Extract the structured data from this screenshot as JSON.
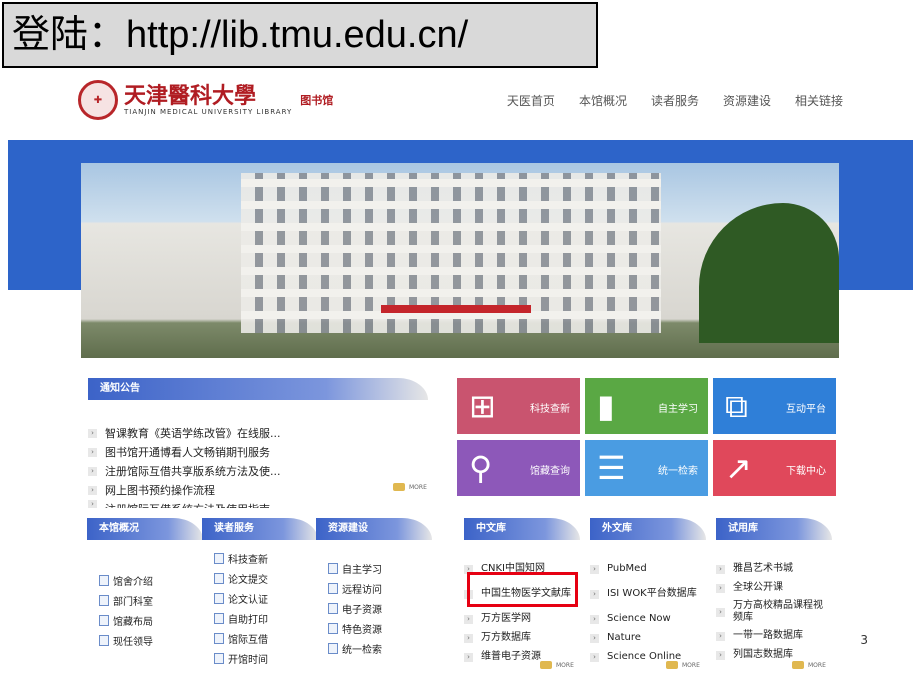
{
  "slide": {
    "title": "登陆：http://lib.tmu.edu.cn/",
    "page_number": "3"
  },
  "site": {
    "logo": {
      "name_cn": "天津醫科大學",
      "name_en": "TIANJIN MEDICAL UNIVERSITY LIBRARY",
      "library": "图书馆"
    },
    "nav": [
      "天医首页",
      "本馆概况",
      "读者服务",
      "资源建设",
      "相关链接"
    ],
    "notice": {
      "title": "通知公告",
      "items": [
        "智课教育《英语学练改管》在线服...",
        "图书馆开通博看人文畅销期刊服务",
        "注册馆际互借共享版系统方法及使...",
        "网上图书预约操作流程",
        "注册馆际互借系统方法及使用指南"
      ],
      "more": "MORE"
    },
    "tiles": [
      {
        "label": "科技查新",
        "icon": "windows-icon",
        "color": "#c9546f"
      },
      {
        "label": "自主学习",
        "icon": "book-icon",
        "color": "#5aa844"
      },
      {
        "label": "互动平台",
        "icon": "chat-faces-icon",
        "color": "#2f7fd8"
      },
      {
        "label": "馆藏查询",
        "icon": "magnifier-icon",
        "color": "#8d58b9"
      },
      {
        "label": "统一检索",
        "icon": "document-icon",
        "color": "#4a9ce2"
      },
      {
        "label": "下载中心",
        "icon": "chart-up-icon",
        "color": "#e0485b"
      }
    ],
    "overview": {
      "title": "本馆概况",
      "items": [
        "馆舍介绍",
        "部门科室",
        "馆藏布局",
        "现任领导"
      ]
    },
    "services": {
      "title": "读者服务",
      "items": [
        "科技查新",
        "论文提交",
        "论文认证",
        "自助打印",
        "馆际互借",
        "开馆时间"
      ]
    },
    "resources": {
      "title": "资源建设",
      "items": [
        "自主学习",
        "远程访问",
        "电子资源",
        "特色资源",
        "统一检索"
      ]
    },
    "chinese_db": {
      "title": "中文库",
      "items": [
        "CNKI中国知网",
        "中国生物医学文献库",
        "万方医学网",
        "万方数据库",
        "维普电子资源"
      ],
      "more": "MORE",
      "highlighted": "中国生物医学文献库"
    },
    "foreign_db": {
      "title": "外文库",
      "items": [
        "PubMed",
        "ISI WOK平台数据库",
        "Science Now",
        "Nature",
        "Science Online"
      ],
      "more": "MORE"
    },
    "trial_db": {
      "title": "试用库",
      "items": [
        "雅昌艺术书城",
        "全球公开课",
        "万方高校精品课程视频库",
        "一带一路数据库",
        "列国志数据库"
      ],
      "more": "MORE"
    }
  }
}
